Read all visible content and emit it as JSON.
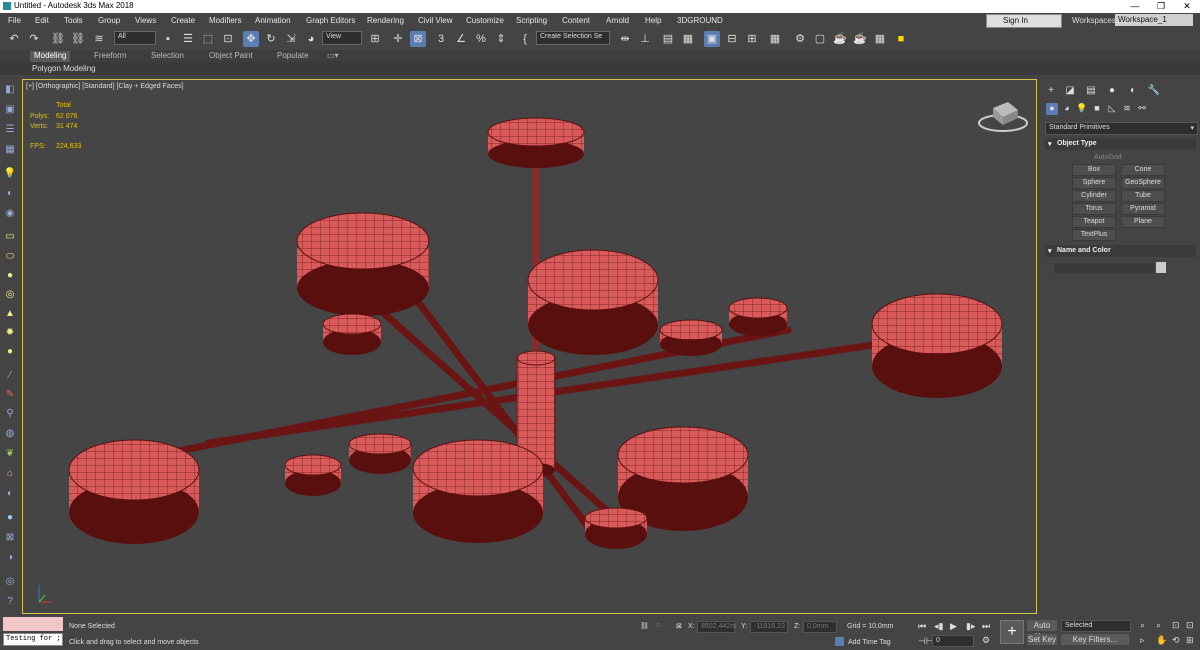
{
  "window": {
    "title": "Untitled - Autodesk 3ds Max 2018",
    "minimize": "—",
    "restore": "❐",
    "close": "✕"
  },
  "menu": [
    "File",
    "Edit",
    "Tools",
    "Group",
    "Views",
    "Create",
    "Modifiers",
    "Animation",
    "Graph Editors",
    "Rendering",
    "Civil View",
    "Customize",
    "Scripting",
    "Content",
    "Arnold",
    "Help",
    "3DGROUND"
  ],
  "account": {
    "signin": "Sign In",
    "workspaces_label": "Workspaces:",
    "workspace": "Workspace_1"
  },
  "toolbar": {
    "filter": "All",
    "ref_coord": "View",
    "selection_set": "Create Selection Se",
    "snap_value": "3",
    "icons": [
      "undo-icon",
      "redo-icon",
      "link-icon",
      "unlink-icon",
      "bind-icon",
      "select-icon",
      "select-by-name-icon",
      "rect-region-icon",
      "window-crossing-icon",
      "move-icon",
      "rotate-icon",
      "scale-icon",
      "pivot-icon",
      "mirror-icon",
      "align-icon",
      "layer-icon",
      "render-icon"
    ]
  },
  "ribbon": {
    "tabs": [
      "Modeling",
      "Freeform",
      "Selection",
      "Object Paint",
      "Populate"
    ],
    "active": "Modeling",
    "panel": "Polygon Modeling"
  },
  "viewport": {
    "label": "[+] [Orthographic] [Standard] [Clay + Edged Faces]",
    "stats": {
      "total_label": "Total",
      "polys_label": "Polys:",
      "polys": "62 076",
      "verts_label": "Verts:",
      "verts": "31 474",
      "fps_label": "FPS:",
      "fps": "224,633"
    }
  },
  "command_panel": {
    "primitive_type": "Standard Primitives",
    "object_type_title": "Object Type",
    "autogrid": "AutoGrid",
    "buttons": [
      "Box",
      "Cone",
      "Sphere",
      "GeoSphere",
      "Cylinder",
      "Tube",
      "Torus",
      "Pyramid",
      "Teapot",
      "Plane",
      "TextPlus"
    ],
    "name_color_title": "Name and Color"
  },
  "status": {
    "maxscript": "Testing for ;",
    "selection": "None Selected",
    "prompt": "Click and drag to select and move objects",
    "x_label": "X:",
    "x": "8502,442m",
    "y_label": "Y:",
    "y": "-11516,22",
    "z_label": "Z:",
    "z": "0,0mm",
    "grid": "Grid = 10,0mm",
    "add_time_tag": "Add Time Tag",
    "frame": "0",
    "auto_key": "Auto Key",
    "set_key": "Set Key",
    "key_mode": "Selected",
    "key_filters": "Key Filters..."
  },
  "colors": {
    "accent": "#5b7fb5",
    "viewport_border": "#d9c24a",
    "mesh_fill": "#d85a5a",
    "mesh_dark": "#5a0f0f",
    "stats_text": "#e6c200"
  }
}
